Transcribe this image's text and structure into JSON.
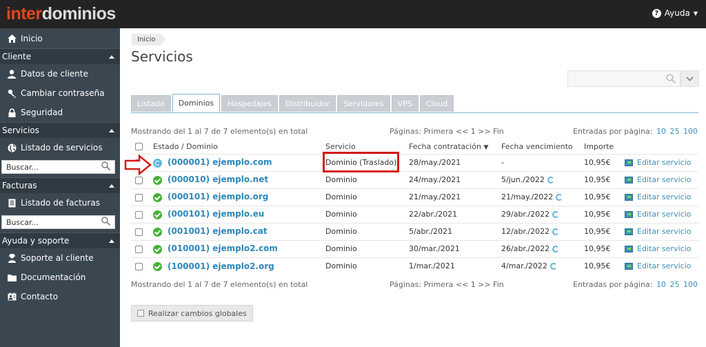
{
  "header": {
    "logo_part1": "inter",
    "logo_part2": "dominios",
    "help_label": "Ayuda"
  },
  "sidebar": {
    "home": "Inicio",
    "sections": [
      {
        "title": "Cliente",
        "items": [
          "Datos de cliente",
          "Cambiar contraseña",
          "Seguridad"
        ]
      },
      {
        "title": "Servicios",
        "items": [
          "Listado de servicios"
        ],
        "search_placeholder": "Buscar..."
      },
      {
        "title": "Facturas",
        "items": [
          "Listado de facturas"
        ],
        "search_placeholder": "Buscar..."
      },
      {
        "title": "Ayuda y soporte",
        "items": [
          "Soporte al cliente",
          "Documentación",
          "Contacto"
        ]
      }
    ]
  },
  "main": {
    "breadcrumb": "Inicio",
    "title": "Servicios",
    "tabs": [
      "Listado",
      "Dominios",
      "Hospedajes",
      "Distribuidor",
      "Servidores",
      "VPS",
      "Cloud"
    ],
    "active_tab": "Dominios",
    "info_text": "Mostrando del 1 al 7 de 7 elemento(s) en total",
    "pagination_text": "Páginas: Primera << 1 >> Fin",
    "per_page_label": "Entradas por página:",
    "per_page_options": [
      "10",
      "25",
      "100"
    ],
    "columns": {
      "estado": "Estado / Dominio",
      "servicio": "Servicio",
      "fecha_contratacion": "Fecha contratación",
      "fecha_vencimiento": "Fecha vencimiento",
      "importe": "Importe"
    },
    "rows": [
      {
        "status": "pending",
        "domain": "(000001) ejemplo.com",
        "service": "Dominio (Traslado)",
        "contracted": "28/may./2021",
        "expires": "-",
        "renew": false,
        "price": "10,95€",
        "action": "Editar servicio"
      },
      {
        "status": "ok",
        "domain": "(000010) ejemplo.net",
        "service": "Dominio",
        "contracted": "24/may./2021",
        "expires": "5/jun./2022",
        "renew": true,
        "price": "10,95€",
        "action": "Editar servicio"
      },
      {
        "status": "ok",
        "domain": "(000101) ejemplo.org",
        "service": "Dominio",
        "contracted": "21/may./2021",
        "expires": "21/may./2022",
        "renew": true,
        "price": "10,95€",
        "action": "Editar servicio"
      },
      {
        "status": "ok",
        "domain": "(000101) ejemplo.eu",
        "service": "Dominio",
        "contracted": "22/abr./2021",
        "expires": "29/abr./2022",
        "renew": true,
        "price": "10,95€",
        "action": "Editar servicio"
      },
      {
        "status": "ok",
        "domain": "(001001) ejemplo.cat",
        "service": "Dominio",
        "contracted": "5/abr./2021",
        "expires": "12/abr./2022",
        "renew": true,
        "price": "10,95€",
        "action": "Editar servicio"
      },
      {
        "status": "ok",
        "domain": "(010001) ejemplo2.com",
        "service": "Dominio",
        "contracted": "30/mar./2021",
        "expires": "26/abr./2022",
        "renew": true,
        "price": "10,95€",
        "action": "Editar servicio"
      },
      {
        "status": "ok",
        "domain": "(100001) ejemplo2.org",
        "service": "Dominio",
        "contracted": "1/mar./2021",
        "expires": "4/mar./2022",
        "renew": true,
        "price": "10,95€",
        "action": "Editar servicio"
      }
    ],
    "global_button": "Realizar cambios globales"
  },
  "colors": {
    "accent": "#3e8fb5",
    "sidebar": "#3a4650",
    "ok": "#45b034",
    "highlight": "#d41a1a"
  }
}
